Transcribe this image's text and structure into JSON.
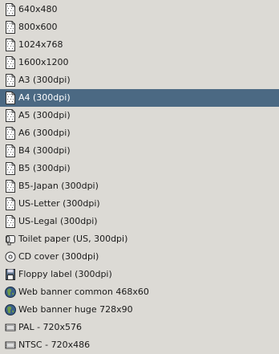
{
  "menu": {
    "selected_index": 5,
    "items": [
      {
        "label": "640x480",
        "icon": "document-icon"
      },
      {
        "label": "800x600",
        "icon": "document-icon"
      },
      {
        "label": "1024x768",
        "icon": "document-icon"
      },
      {
        "label": "1600x1200",
        "icon": "document-icon"
      },
      {
        "label": "A3 (300dpi)",
        "icon": "document-icon"
      },
      {
        "label": "A4 (300dpi)",
        "icon": "document-icon"
      },
      {
        "label": "A5 (300dpi)",
        "icon": "document-icon"
      },
      {
        "label": "A6 (300dpi)",
        "icon": "document-icon"
      },
      {
        "label": "B4 (300dpi)",
        "icon": "document-icon"
      },
      {
        "label": "B5 (300dpi)",
        "icon": "document-icon"
      },
      {
        "label": "B5-Japan (300dpi)",
        "icon": "document-icon"
      },
      {
        "label": "US-Letter (300dpi)",
        "icon": "document-icon"
      },
      {
        "label": "US-Legal (300dpi)",
        "icon": "document-icon"
      },
      {
        "label": "Toilet paper (US, 300dpi)",
        "icon": "toilet-paper-icon"
      },
      {
        "label": "CD cover (300dpi)",
        "icon": "cd-icon"
      },
      {
        "label": "Floppy label (300dpi)",
        "icon": "floppy-icon"
      },
      {
        "label": "Web banner common 468x60",
        "icon": "globe-icon"
      },
      {
        "label": "Web banner huge 728x90",
        "icon": "globe-icon"
      },
      {
        "label": "PAL - 720x576",
        "icon": "video-icon"
      },
      {
        "label": "NTSC - 720x486",
        "icon": "video-icon"
      }
    ]
  },
  "colors": {
    "background": "#dcdad5",
    "selection": "#4b6983",
    "selection_text": "#ffffff"
  }
}
